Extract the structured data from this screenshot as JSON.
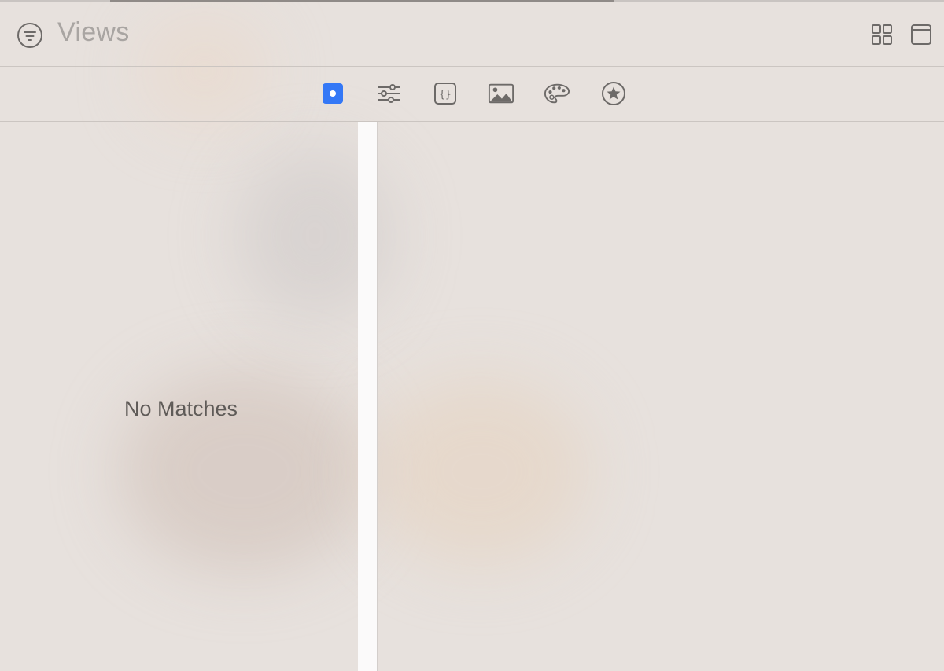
{
  "header": {
    "title": "Views",
    "filter_icon": "filter-circle-icon",
    "grid_icon": "grid-view-icon",
    "window_icon": "window-icon"
  },
  "toolbar": {
    "items": [
      {
        "icon": "object-library-icon",
        "selected": true
      },
      {
        "icon": "modifiers-icon",
        "selected": false
      },
      {
        "icon": "code-snippets-icon",
        "selected": false
      },
      {
        "icon": "media-icon",
        "selected": false
      },
      {
        "icon": "color-palette-icon",
        "selected": false
      },
      {
        "icon": "favorites-star-icon",
        "selected": false
      }
    ]
  },
  "list": {
    "empty_text": "No Matches"
  },
  "colors": {
    "accent": "#3478f6",
    "icon": "#6d6a68",
    "background": "#e7e1dd"
  }
}
